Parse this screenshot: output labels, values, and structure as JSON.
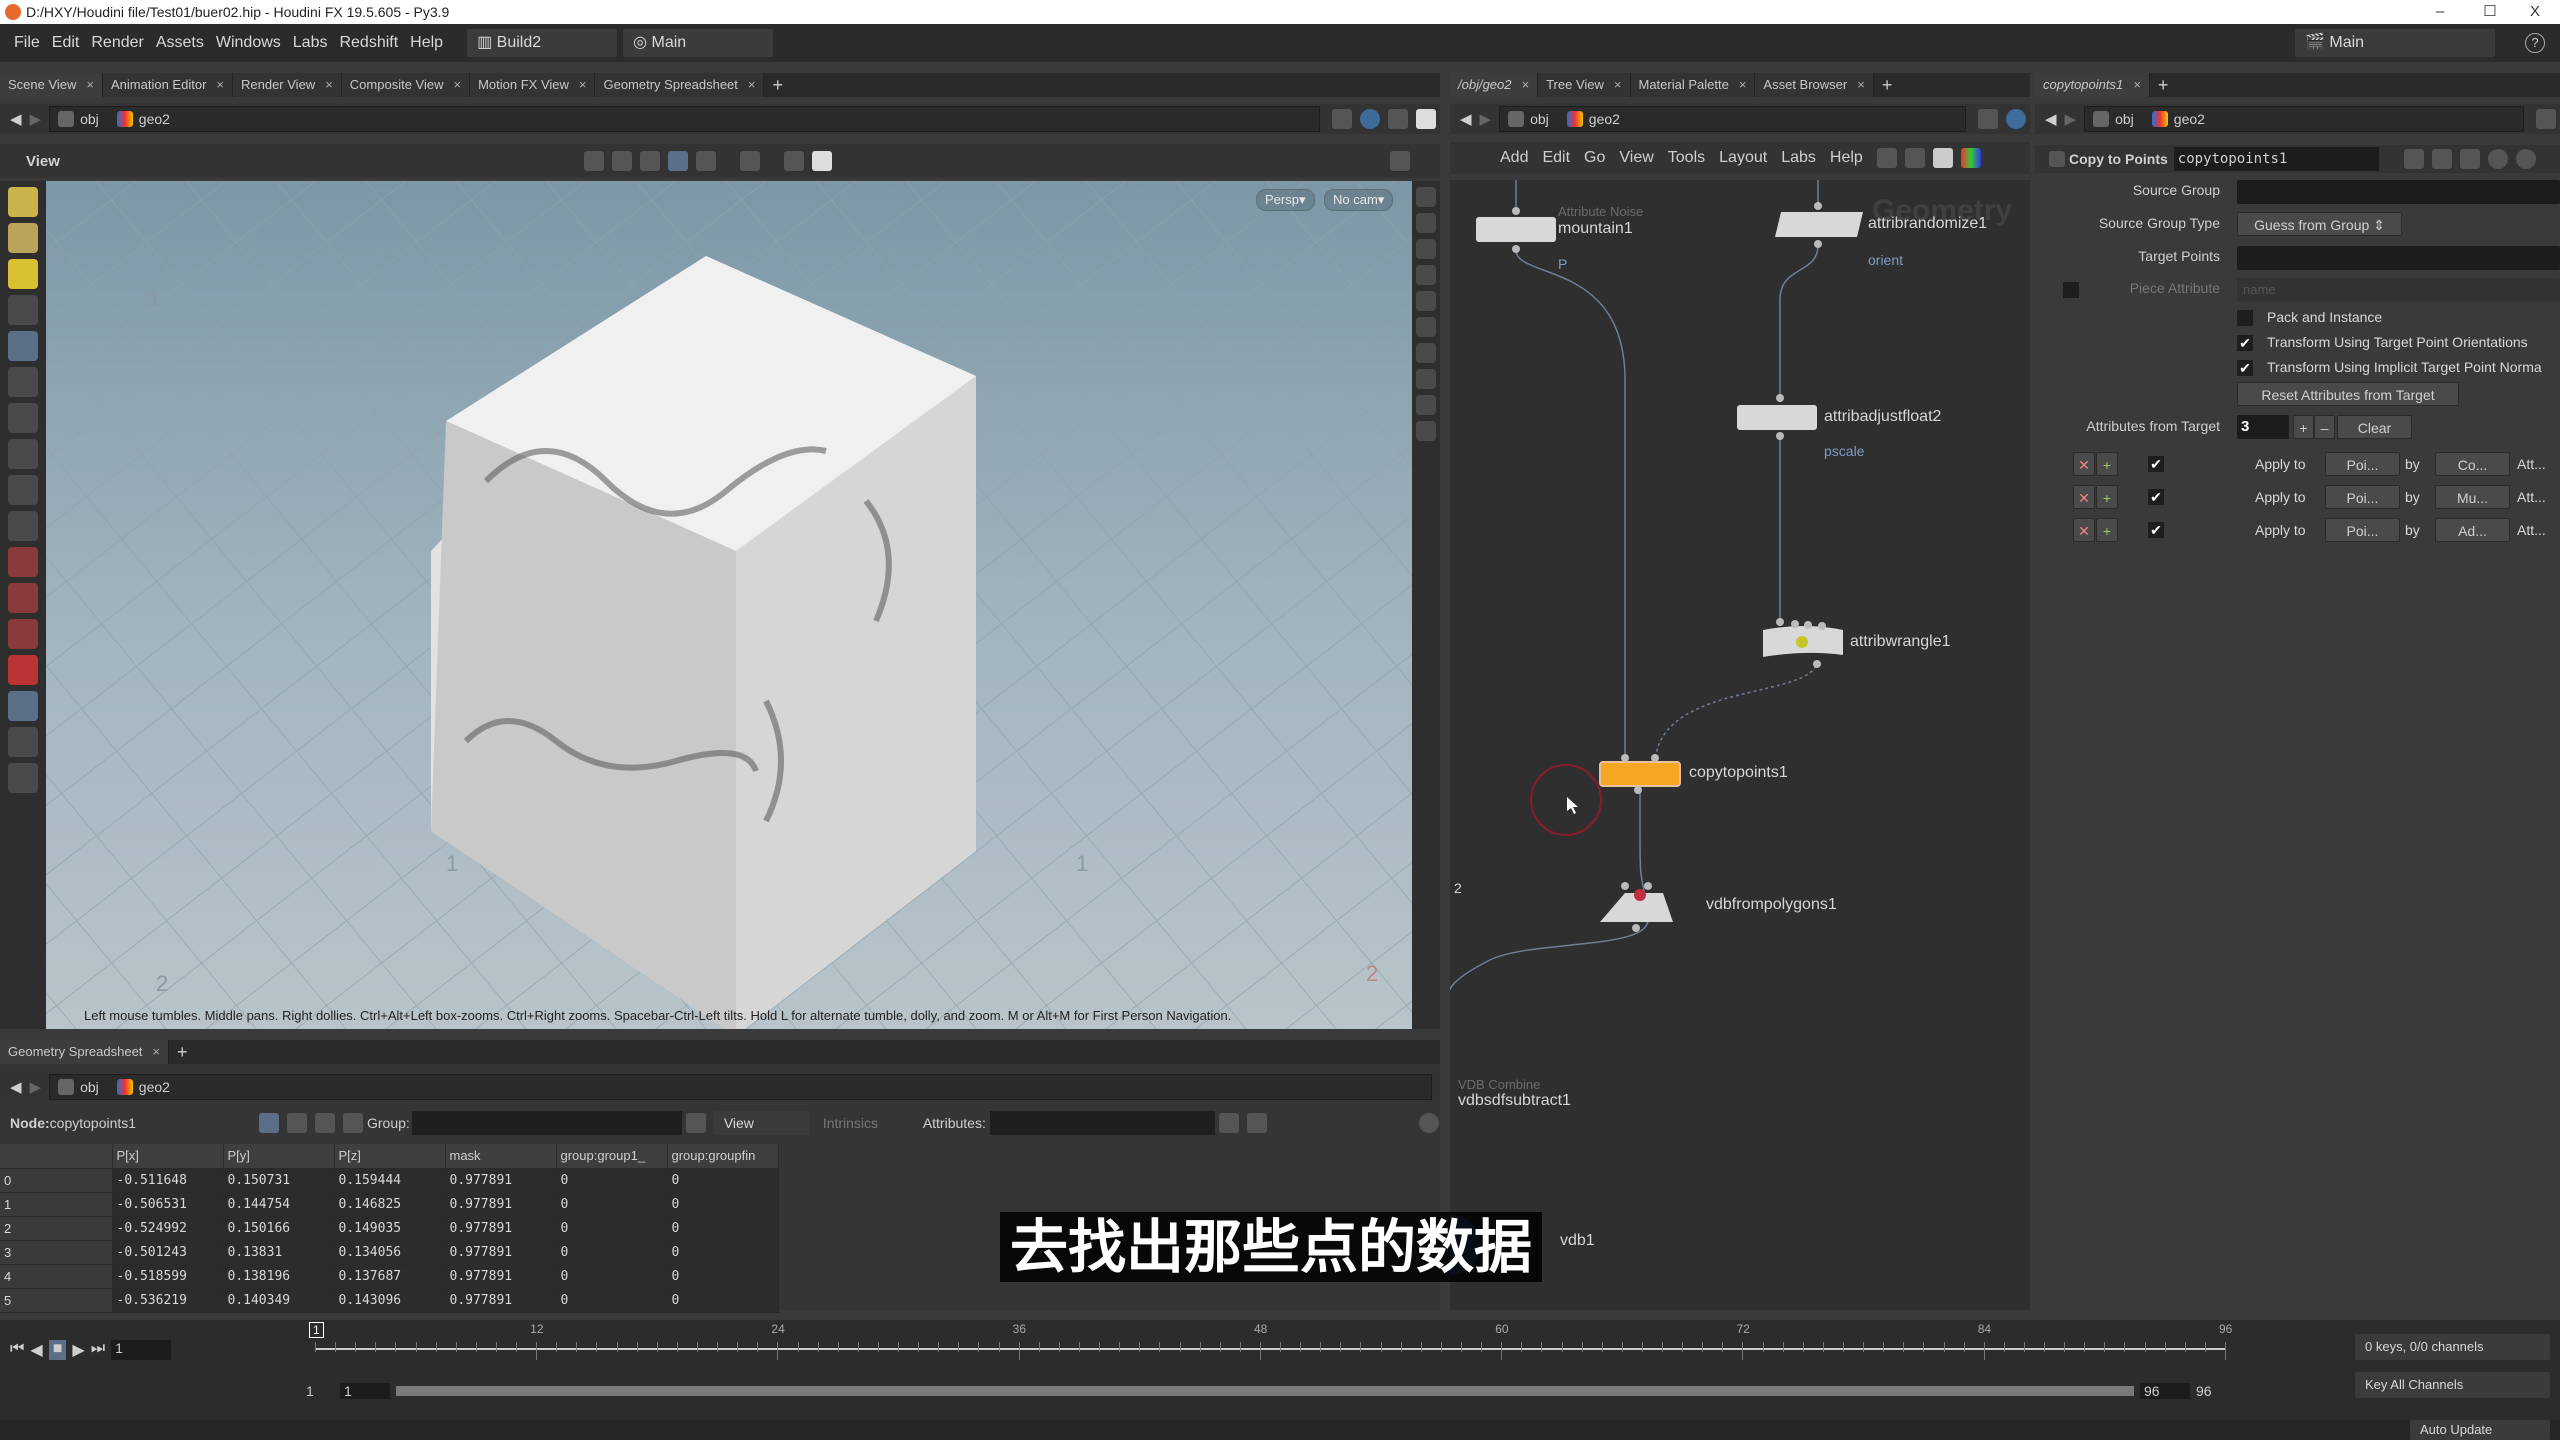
{
  "window": {
    "title": "D:/HXY/Houdini file/Test01/buer02.hip - Houdini FX 19.5.605 - Py3.9",
    "min": "–",
    "max": "☐",
    "close": "X"
  },
  "menu": {
    "items": [
      "File",
      "Edit",
      "Render",
      "Assets",
      "Windows",
      "Labs",
      "Redshift",
      "Help"
    ],
    "desktop": "Build2",
    "context": "Main",
    "right_context": "Main",
    "help": "?"
  },
  "left_pane": {
    "tabs": [
      "Scene View",
      "Animation Editor",
      "Render View",
      "Composite View",
      "Motion FX View",
      "Geometry Spreadsheet"
    ],
    "path": [
      "obj",
      "geo2"
    ],
    "view_label": "View"
  },
  "viewport": {
    "persp": "Persp▾",
    "cam": "No cam▾",
    "hint": "Left mouse tumbles. Middle pans. Right dollies. Ctrl+Alt+Left box-zooms. Ctrl+Right zooms. Spacebar-Ctrl-Left tilts. Hold L for alternate tumble, dolly, and zoom.     M or Alt+M for First Person Navigation.",
    "grid_labels": [
      "-1",
      "1",
      "1",
      "2",
      "2"
    ]
  },
  "network": {
    "tabs": [
      "/obj/geo2",
      "Tree View",
      "Material Palette",
      "Asset Browser"
    ],
    "path": [
      "obj",
      "geo2"
    ],
    "menu": [
      "Add",
      "Edit",
      "Go",
      "View",
      "Tools",
      "Layout",
      "Labs",
      "Help"
    ],
    "watermark": "Geometry",
    "nodes": [
      {
        "name": "mountain1",
        "type": "Attribute Noise",
        "attr": "P"
      },
      {
        "name": "attribrandomize1",
        "attr": "orient"
      },
      {
        "name": "attribadjustfloat2",
        "attr": "pscale"
      },
      {
        "name": "attribwrangle1"
      },
      {
        "name": "copytopoints1",
        "selected": true
      },
      {
        "name": "vdbfrompolygons1"
      },
      {
        "name": "vdbsdfsubtract1",
        "type": "VDB Combine"
      },
      {
        "name": "vdb1"
      }
    ],
    "edge_label": "2"
  },
  "params": {
    "tab": "copytopoints1",
    "path": [
      "obj",
      "geo2"
    ],
    "node_type": "Copy to Points",
    "node_name": "copytopoints1",
    "source_group": "Source Group",
    "source_group_type": "Source Group Type",
    "source_group_type_value": "Guess from Group",
    "target_points": "Target Points",
    "piece_attribute": "Piece Attribute",
    "piece_attribute_placeholder": "name",
    "pack_and_instance": {
      "label": "Pack and Instance",
      "checked": false
    },
    "transform_orient": {
      "label": "Transform Using Target Point Orientations",
      "checked": true
    },
    "transform_normal": {
      "label": "Transform Using Implicit Target Point Norma",
      "checked": true
    },
    "reset_button": "Reset Attributes from Target",
    "attrs_from_target": "Attributes from Target",
    "attrs_count": "3",
    "plus": "+",
    "minus": "–",
    "clear": "Clear",
    "rows": [
      {
        "apply": "Apply to",
        "target": "Poi...",
        "by": "by",
        "op": "Co...",
        "att": "Att..."
      },
      {
        "apply": "Apply to",
        "target": "Poi...",
        "by": "by",
        "op": "Mu...",
        "att": "Att..."
      },
      {
        "apply": "Apply to",
        "target": "Poi...",
        "by": "by",
        "op": "Ad...",
        "att": "Att..."
      }
    ]
  },
  "spreadsheet": {
    "tab": "Geometry Spreadsheet",
    "path": [
      "obj",
      "geo2"
    ],
    "node_label": "Node:",
    "node": "copytopoints1",
    "group_label": "Group:",
    "view": "View",
    "intrinsics": "Intrinsics",
    "attributes_label": "Attributes:",
    "columns": [
      "",
      "P[x]",
      "P[y]",
      "P[z]",
      "mask",
      "group:group1_",
      "group:groupfin"
    ],
    "rows": [
      [
        "0",
        "-0.511648",
        "0.150731",
        "0.159444",
        "0.977891",
        "0",
        "0"
      ],
      [
        "1",
        "-0.506531",
        "0.144754",
        "0.146825",
        "0.977891",
        "0",
        "0"
      ],
      [
        "2",
        "-0.524992",
        "0.150166",
        "0.149035",
        "0.977891",
        "0",
        "0"
      ],
      [
        "3",
        "-0.501243",
        "0.13831",
        "0.134056",
        "0.977891",
        "0",
        "0"
      ],
      [
        "4",
        "-0.518599",
        "0.138196",
        "0.137687",
        "0.977891",
        "0",
        "0"
      ],
      [
        "5",
        "-0.536219",
        "0.140349",
        "0.143096",
        "0.977891",
        "0",
        "0"
      ]
    ]
  },
  "timeline": {
    "current_frame": "1",
    "ticks": [
      "1",
      "12",
      "24",
      "36",
      "48",
      "60",
      "72",
      "84",
      "96"
    ],
    "range_start": "1",
    "range_start2": "1",
    "range_end": "96",
    "range_end2": "96",
    "keys": "0 keys, 0/0 channels",
    "key_all": "Key All Channels",
    "auto_update": "Auto Update"
  },
  "subtitle": "去找出那些点的数据"
}
